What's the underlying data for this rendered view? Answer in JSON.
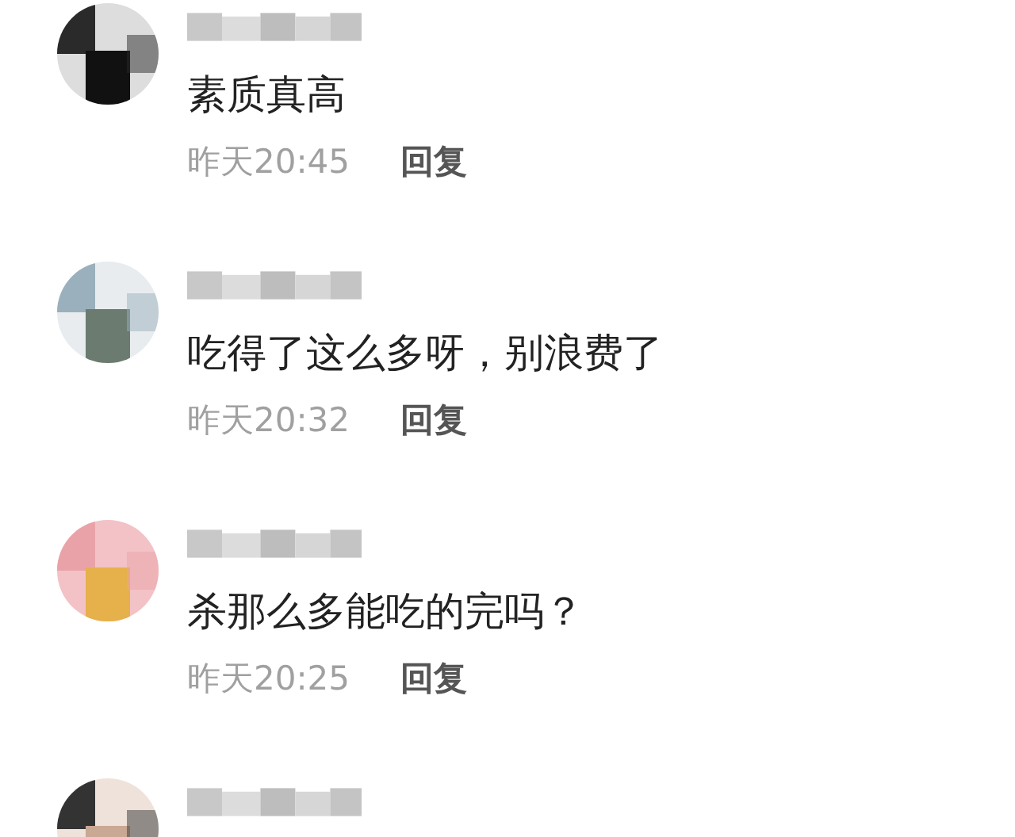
{
  "comments": [
    {
      "kind": "full",
      "text": "素质真高",
      "time": "昨天20:45",
      "reply": "回复"
    },
    {
      "kind": "full",
      "text": "吃得了这么多呀，别浪费了",
      "time": "昨天20:32",
      "reply": "回复"
    },
    {
      "kind": "full",
      "text": "杀那么多能吃的完吗？",
      "time": "昨天20:25",
      "reply": "回复"
    },
    {
      "kind": "header_only"
    }
  ]
}
